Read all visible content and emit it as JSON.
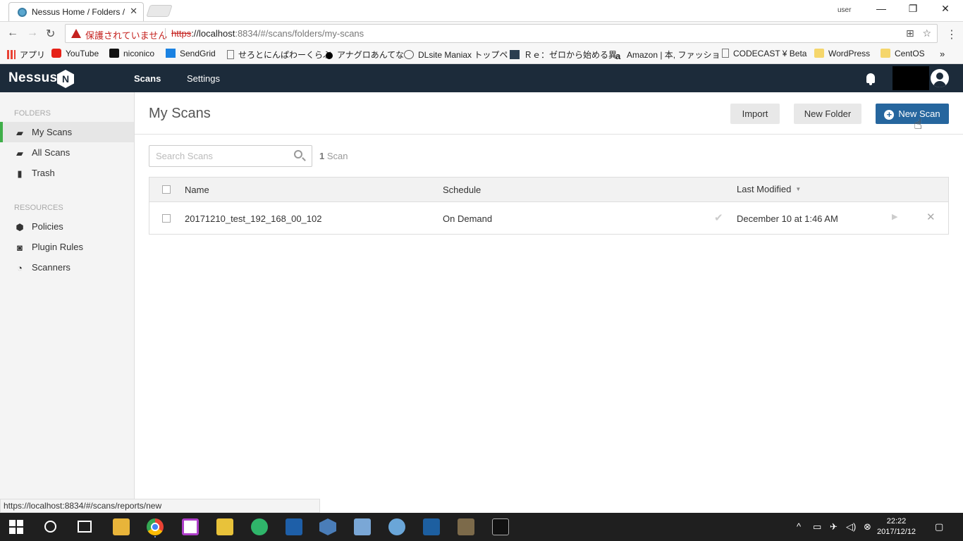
{
  "browser": {
    "tab_title": "Nessus Home / Folders / My Scans",
    "tab_close": "✕",
    "user_label": "user",
    "security_warning": "保護されていません",
    "url_proto": "https",
    "url_host": "://localhost",
    "url_rest": ":8834/#/scans/folders/my-scans"
  },
  "bookmarks": [
    {
      "label": "アプリ",
      "icon": "apps-grid-icon"
    },
    {
      "label": "YouTube",
      "icon": "youtube-icon"
    },
    {
      "label": "niconico",
      "icon": "niconico-icon"
    },
    {
      "label": "SendGrid",
      "icon": "sendgrid-icon"
    },
    {
      "label": "せろとにんぱわーくらぶ",
      "icon": "page-icon"
    },
    {
      "label": "アナグロあんてな",
      "icon": "dot-icon"
    },
    {
      "label": "DLsite Maniax トップペ",
      "icon": "dlsite-icon"
    },
    {
      "label": "Ｒｅ：ゼロから始める異",
      "icon": "re-zero-icon"
    },
    {
      "label": "Amazon | 本, ファッショ",
      "icon": "amazon-icon"
    },
    {
      "label": "CODECAST ¥ Beta",
      "icon": "page-icon"
    },
    {
      "label": "WordPress",
      "icon": "folder-icon"
    },
    {
      "label": "CentOS",
      "icon": "folder-icon"
    }
  ],
  "header": {
    "logo": "Nessus",
    "logo_badge": "N",
    "nav": [
      "Scans",
      "Settings"
    ]
  },
  "sidebar": {
    "folders_label": "FOLDERS",
    "folders": [
      {
        "label": "My Scans",
        "icon": "folder-open-icon"
      },
      {
        "label": "All Scans",
        "icon": "folder-icon"
      },
      {
        "label": "Trash",
        "icon": "trash-icon"
      }
    ],
    "resources_label": "RESOURCES",
    "resources": [
      {
        "label": "Policies",
        "icon": "shield-icon"
      },
      {
        "label": "Plugin Rules",
        "icon": "plugin-icon"
      },
      {
        "label": "Scanners",
        "icon": "radar-icon"
      }
    ]
  },
  "main": {
    "title": "My Scans",
    "buttons": {
      "import": "Import",
      "new_folder": "New Folder",
      "new_scan": "New Scan"
    },
    "search_placeholder": "Search Scans",
    "count_num": "1",
    "count_label": " Scan",
    "columns": [
      "Name",
      "Schedule",
      "Last Modified"
    ],
    "rows": [
      {
        "name": "20171210_test_192_168_00_102",
        "schedule": "On Demand",
        "last_modified": "December 10 at 1:46 AM",
        "status": "completed"
      }
    ]
  },
  "status_url": "https://localhost:8834/#/scans/reports/new",
  "taskbar": {
    "time": "22:22",
    "date": "2017/12/12"
  },
  "colors": {
    "header_bg": "#1c2b3a",
    "primary_button": "#26669e",
    "active_indicator": "#3fae49",
    "warning": "#c5221f"
  }
}
